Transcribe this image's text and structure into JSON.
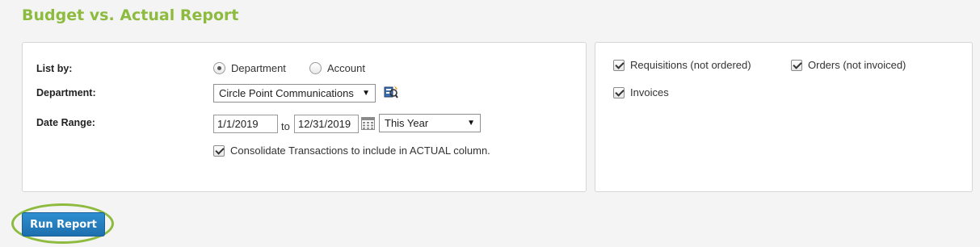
{
  "page": {
    "title": "Budget vs. Actual Report"
  },
  "form": {
    "list_by": {
      "label": "List by:",
      "options": [
        "Department",
        "Account"
      ],
      "selected": "Department"
    },
    "department": {
      "label": "Department:",
      "value": "Circle Point Communications"
    },
    "date_range": {
      "label": "Date Range:",
      "from": "1/1/2019",
      "to_text": "to",
      "to": "12/31/2019",
      "preset": "This Year"
    },
    "consolidate": {
      "label": "Consolidate Transactions to include in ACTUAL column.",
      "checked": true
    }
  },
  "include": {
    "requisitions": {
      "label": "Requisitions (not ordered)",
      "checked": true
    },
    "orders": {
      "label": "Orders (not invoiced)",
      "checked": true
    },
    "invoices": {
      "label": "Invoices",
      "checked": true
    }
  },
  "actions": {
    "run_report": "Run Report"
  },
  "colors": {
    "accent_green": "#8dbb3e",
    "button_blue": "#1d6fae"
  },
  "icons": {
    "department_picker": "department-lookup-icon",
    "calendar": "calendar-icon"
  }
}
